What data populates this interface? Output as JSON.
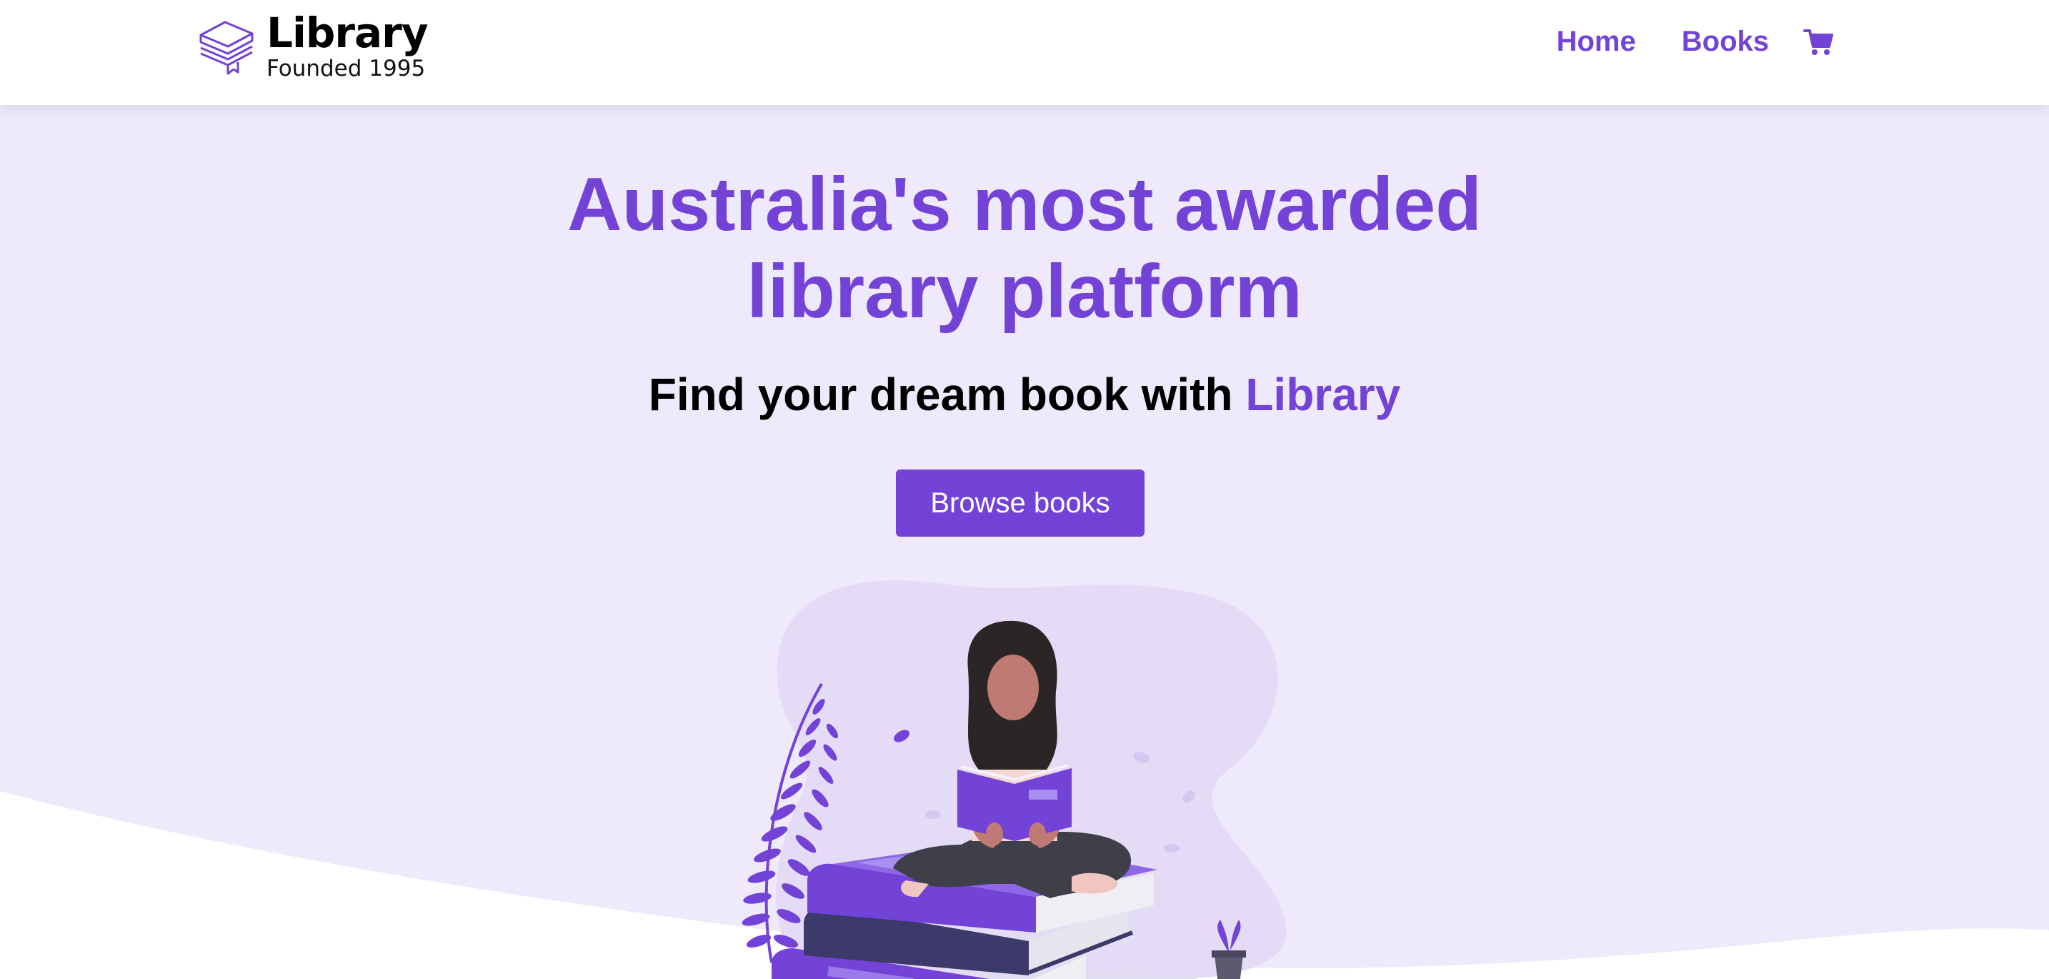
{
  "navbar": {
    "logo": {
      "icon": "book-stack-icon",
      "title": "Library",
      "subtitle": "Founded 1995"
    },
    "links": [
      {
        "label": "Home"
      },
      {
        "label": "Books"
      }
    ],
    "cart_icon": "cart-icon"
  },
  "hero": {
    "title_line1": "Australia's most awarded",
    "title_line2": "library platform",
    "subtitle_prefix": "Find your dream book with ",
    "subtitle_brand": "Library",
    "cta_label": "Browse books",
    "illustration": "woman-reading-on-books-illustration"
  },
  "colors": {
    "accent": "#7342d6",
    "hero_bg": "#efeafb",
    "text": "#000000"
  }
}
